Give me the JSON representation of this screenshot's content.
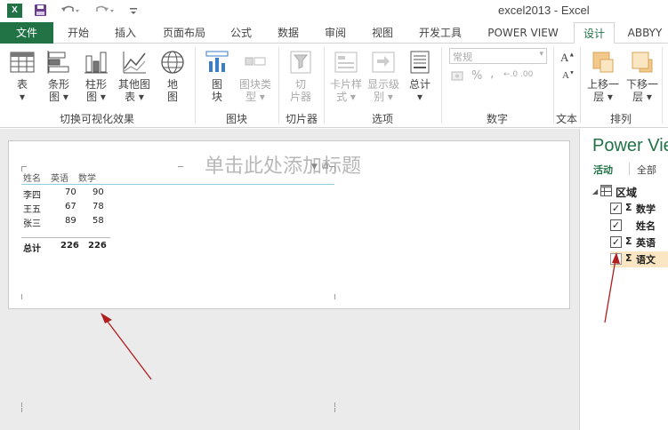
{
  "window": {
    "title": "excel2013 - Excel"
  },
  "qat": {
    "logo": "X",
    "icons": [
      "save-icon",
      "undo-icon",
      "redo-icon",
      "customize-icon"
    ]
  },
  "tabs": [
    {
      "label": "文件"
    },
    {
      "label": "开始"
    },
    {
      "label": "插入"
    },
    {
      "label": "页面布局"
    },
    {
      "label": "公式"
    },
    {
      "label": "数据"
    },
    {
      "label": "审阅"
    },
    {
      "label": "视图"
    },
    {
      "label": "开发工具"
    },
    {
      "label": "POWER VIEW"
    },
    {
      "label": "设计"
    },
    {
      "label": "ABBYY"
    }
  ],
  "ribbon": {
    "switch_viz": {
      "buttons": [
        {
          "label": "表",
          "sub": "▾"
        },
        {
          "label": "条形",
          "sub": "图 ▾"
        },
        {
          "label": "柱形",
          "sub": "图 ▾"
        },
        {
          "label": "其他图",
          "sub": "表 ▾"
        },
        {
          "label": "地",
          "sub": "图"
        }
      ],
      "group_label": "切换可视化效果"
    },
    "tiles": {
      "buttons": [
        {
          "label": "图",
          "sub": "块"
        },
        {
          "label": "图块类",
          "sub": "型 ▾"
        }
      ],
      "group_label": "图块"
    },
    "slicer": {
      "buttons": [
        {
          "label": "切",
          "sub": "片器"
        }
      ],
      "group_label": "切片器"
    },
    "options": {
      "buttons": [
        {
          "label": "卡片样",
          "sub": "式 ▾"
        },
        {
          "label": "显示级",
          "sub": "别 ▾"
        },
        {
          "label": "总计",
          "sub": "▾"
        }
      ],
      "group_label": "选项"
    },
    "number": {
      "format_value": "常规",
      "percent": "%",
      "comma": ",",
      "inc_dec": "←.0  .00",
      "group_label": "数字"
    },
    "text": {
      "group_label": "文本"
    },
    "arrange": {
      "buttons": [
        {
          "label": "上移一",
          "sub": "层 ▾"
        },
        {
          "label": "下移一",
          "sub": "层 ▾"
        }
      ],
      "group_label": "排列"
    }
  },
  "view": {
    "title_placeholder": "单击此处添加标题",
    "table": {
      "headers": [
        "姓名",
        "英语",
        "数学"
      ],
      "rows": [
        [
          "李四",
          "70",
          "90"
        ],
        [
          "王五",
          "67",
          "78"
        ],
        [
          "张三",
          "89",
          "58"
        ]
      ],
      "total": [
        "总计",
        "226",
        "226"
      ]
    }
  },
  "field_panel": {
    "title": "Power View",
    "tabs": [
      "活动",
      "全部"
    ],
    "section": "区域",
    "fields": [
      {
        "name": "数学",
        "checked": true,
        "sigma": true
      },
      {
        "name": "姓名",
        "checked": true,
        "sigma": false
      },
      {
        "name": "英语",
        "checked": true,
        "sigma": true
      },
      {
        "name": "语文",
        "checked": false,
        "sigma": true
      }
    ],
    "check_glyph": "✓",
    "sigma_glyph": "Σ"
  },
  "colors": {
    "accent": "#217346",
    "highlight": "#fbe6c3",
    "arrow": "#b01e1e"
  }
}
